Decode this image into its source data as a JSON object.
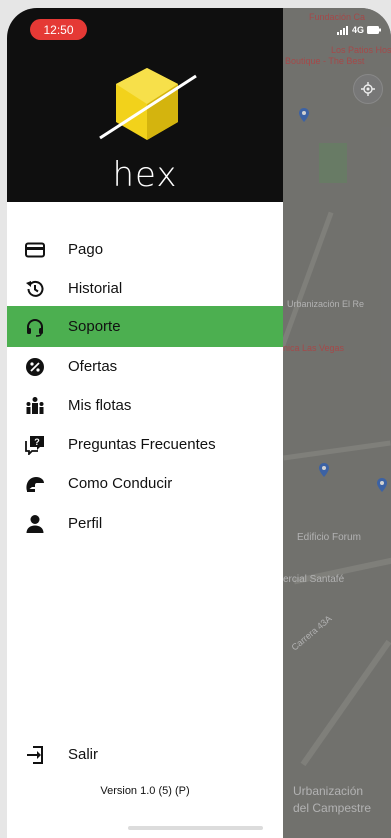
{
  "status_bar": {
    "time": "12:50",
    "network": "4G"
  },
  "drawer": {
    "brand": "hex",
    "menu": [
      {
        "id": "pago",
        "label": "Pago",
        "icon": "credit-card-icon"
      },
      {
        "id": "historial",
        "label": "Historial",
        "icon": "history-icon"
      },
      {
        "id": "soporte",
        "label": "Soporte",
        "icon": "headset-icon",
        "active": true
      },
      {
        "id": "ofertas",
        "label": "Ofertas",
        "icon": "percent-badge-icon"
      },
      {
        "id": "mis-flotas",
        "label": "Mis flotas",
        "icon": "fleet-icon"
      },
      {
        "id": "preguntas",
        "label": "Preguntas Frecuentes",
        "icon": "faq-chat-icon"
      },
      {
        "id": "como-conducir",
        "label": "Como Conducir",
        "icon": "helmet-icon"
      },
      {
        "id": "perfil",
        "label": "Perfil",
        "icon": "person-icon"
      }
    ],
    "logout": {
      "label": "Salir",
      "icon": "logout-icon"
    },
    "version": "Version 1.0 (5) (P)"
  },
  "map": {
    "labels": [
      "Fundación Ca",
      "Los Patios Hostel",
      "Boutique - The Best",
      "Urbanización El Re",
      "nica Las Vegas",
      "Edificio Forum",
      "ercial Santafé",
      "Carrera 43A",
      "Urbanización",
      "del Campestre"
    ]
  },
  "colors": {
    "accent_green": "#4caf50",
    "header_black": "#0f0f0f",
    "time_pill_red": "#e53935",
    "logo_yellow": "#f2d21b"
  }
}
